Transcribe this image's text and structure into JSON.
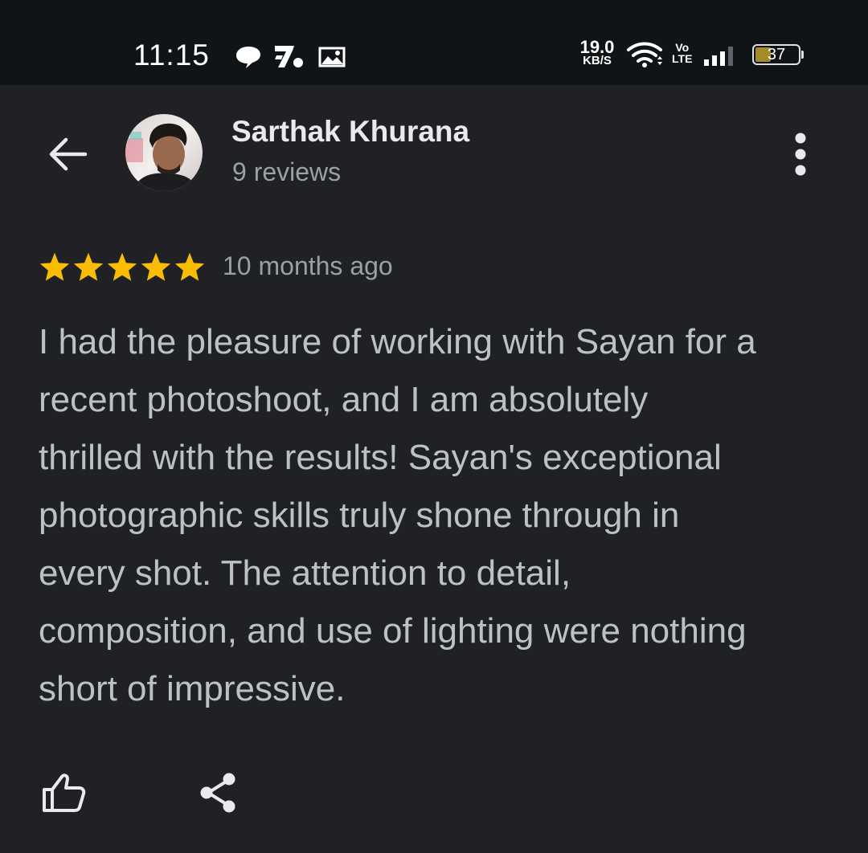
{
  "status_bar": {
    "time": "11:15",
    "net_speed": "19.0",
    "net_unit": "KB/S",
    "volte_top": "Vo",
    "volte_bottom": "LTE",
    "battery_level": "37",
    "battery_fraction": 0.37,
    "icons": [
      "chat-bubble-icon",
      "app-notification-icon",
      "gallery-icon",
      "wifi-icon",
      "signal-icon",
      "battery-icon"
    ]
  },
  "header": {
    "back_icon": "arrow-left-icon",
    "reviewer_name": "Sarthak Khurana",
    "review_count": "9 reviews",
    "more_icon": "more-vert-icon"
  },
  "review": {
    "rating": 5,
    "max_rating": 5,
    "star_color": "#fbbc04",
    "date": "10 months ago",
    "lines": [
      "I had the pleasure of working with Sayan for a",
      "recent photoshoot, and I am absolutely",
      "thrilled with the results! Sayan's exceptional",
      "photographic skills truly shone through in",
      "every shot. The attention to detail,",
      "composition, and use of lighting were nothing",
      "short of impressive."
    ]
  },
  "actions": {
    "like_icon": "thumbs-up-icon",
    "share_icon": "share-icon"
  },
  "colors": {
    "background": "#202124",
    "status_bar": "#111416",
    "primary_text": "#e8eaed",
    "secondary_text": "#9aa0a6",
    "body_text": "#bdc1c6",
    "battery_fill": "#a58a28"
  }
}
